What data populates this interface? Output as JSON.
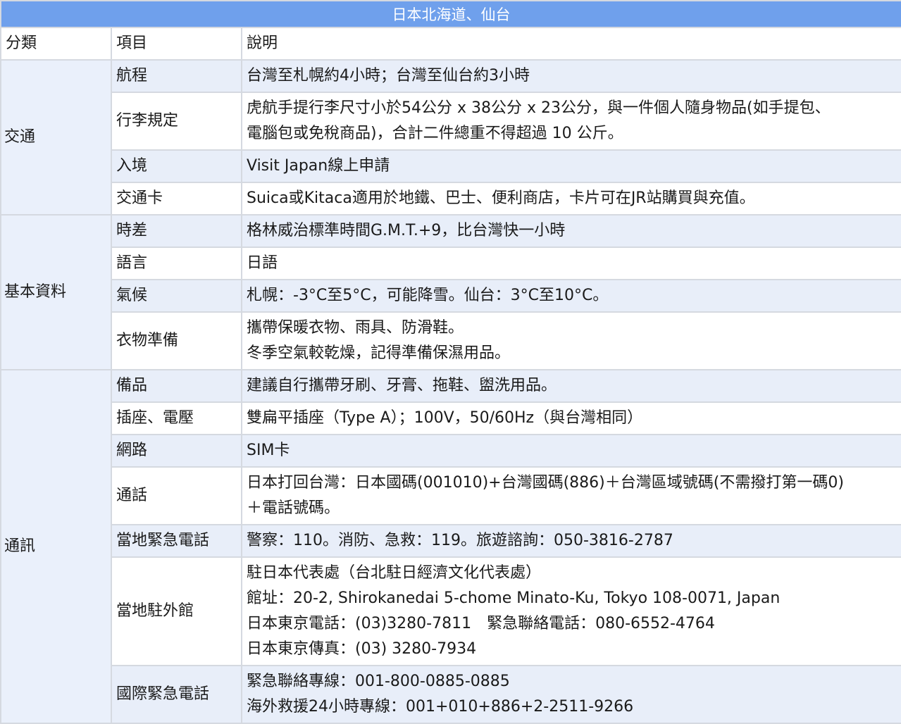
{
  "title": "日本北海道、仙台",
  "headers": {
    "category": "分類",
    "item": "項目",
    "description": "說明"
  },
  "sections": [
    {
      "category": "交通",
      "rows": [
        {
          "item": "航程",
          "lines": [
            "台灣至札幌約4小時；台灣至仙台約3小時"
          ]
        },
        {
          "item": "行李規定",
          "lines": [
            "虎航手提行李尺寸小於54公分 x 38公分 x 23公分，與一件個人隨身物品(如手提包、",
            "電腦包或免稅商品)，合計二件總重不得超過 10 公斤。"
          ]
        },
        {
          "item": "入境",
          "lines": [
            "Visit Japan線上申請"
          ]
        },
        {
          "item": "交通卡",
          "lines": [
            "Suica或Kitaca適用於地鐵、巴士、便利商店，卡片可在JR站購買與充值。"
          ]
        }
      ]
    },
    {
      "category": "基本資料",
      "rows": [
        {
          "item": "時差",
          "lines": [
            "格林威治標準時間G.M.T.+9，比台灣快一小時"
          ]
        },
        {
          "item": "語言",
          "lines": [
            "日語"
          ]
        },
        {
          "item": "氣候",
          "lines": [
            "札幌：-3°C至5°C，可能降雪。仙台：3°C至10°C。"
          ]
        },
        {
          "item": "衣物準備",
          "lines": [
            "攜帶保暖衣物、雨具、防滑鞋。",
            "冬季空氣較乾燥，記得準備保濕用品。"
          ]
        }
      ]
    },
    {
      "category": "通訊",
      "rows": [
        {
          "item": "備品",
          "lines": [
            "建議自行攜帶牙刷、牙膏、拖鞋、盥洗用品。"
          ]
        },
        {
          "item": "插座、電壓",
          "lines": [
            "雙扁平插座（Type A）；100V，50/60Hz（與台灣相同）"
          ]
        },
        {
          "item": "網路",
          "lines": [
            "SIM卡"
          ]
        },
        {
          "item": "通話",
          "lines": [
            "日本打回台灣：日本國碼(001010)+台灣國碼(886)＋台灣區域號碼(不需撥打第一碼0)",
            "＋電話號碼。"
          ]
        },
        {
          "item": "當地緊急電話",
          "lines": [
            "警察：110。消防、急救：119。旅遊諮詢：050-3816-2787"
          ]
        },
        {
          "item": "當地駐外館",
          "lines": [
            "駐日本代表處（台北駐日經濟文化代表處）",
            "館址：20-2, Shirokanedai 5-chome Minato-Ku, Tokyo 108-0071, Japan",
            "日本東京電話：(03)3280-7811　緊急聯絡電話：080-6552-4764",
            "日本東京傳真：(03) 3280-7934"
          ]
        },
        {
          "item": "國際緊急電話",
          "lines": [
            "緊急聯絡專線：001-800-0885-0885",
            "海外救援24小時專線：001+010+886+2-2511-9266"
          ]
        }
      ]
    }
  ]
}
